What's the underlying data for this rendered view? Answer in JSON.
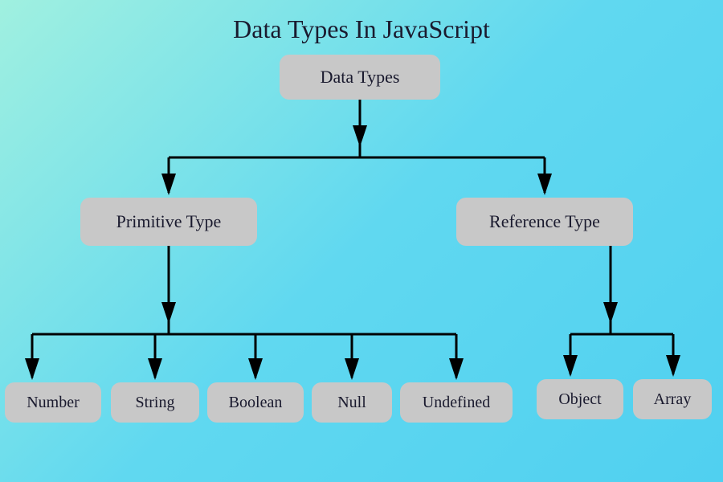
{
  "title": "Data Types In JavaScript",
  "root": {
    "label": "Data Types"
  },
  "level1": {
    "primitive": {
      "label": "Primitive Type"
    },
    "reference": {
      "label": "Reference Type"
    }
  },
  "primitive_children": {
    "number": {
      "label": "Number"
    },
    "string": {
      "label": "String"
    },
    "boolean": {
      "label": "Boolean"
    },
    "null": {
      "label": "Null"
    },
    "undefined": {
      "label": "Undefined"
    }
  },
  "reference_children": {
    "object": {
      "label": "Object"
    },
    "array": {
      "label": "Array"
    }
  }
}
